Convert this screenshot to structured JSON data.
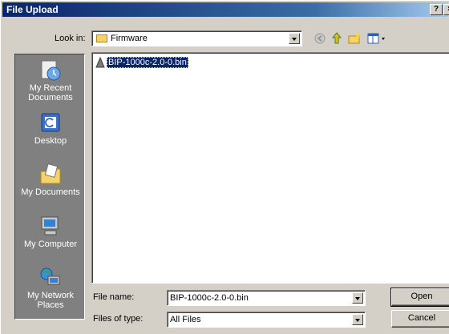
{
  "window": {
    "title": "File Upload",
    "help_glyph": "?",
    "close_glyph": "×"
  },
  "lookin": {
    "label": "Look in:",
    "value": "Firmware"
  },
  "toolbar": {
    "icons": [
      "back-icon",
      "up-folder-icon",
      "new-folder-icon",
      "view-menu-icon"
    ]
  },
  "places": [
    {
      "label": "My Recent Documents",
      "icon": "recent-documents-icon"
    },
    {
      "label": "Desktop",
      "icon": "desktop-icon"
    },
    {
      "label": "My Documents",
      "icon": "my-documents-icon"
    },
    {
      "label": "My Computer",
      "icon": "my-computer-icon"
    },
    {
      "label": "My Network Places",
      "icon": "network-places-icon"
    }
  ],
  "files": [
    {
      "name": "BIP-1000c-2.0-0.bin",
      "selected": true
    }
  ],
  "filename": {
    "label": "File name:",
    "value": "BIP-1000c-2.0-0.bin"
  },
  "filetype": {
    "label": "Files of type:",
    "value": "All Files"
  },
  "buttons": {
    "open": "Open",
    "cancel": "Cancel"
  }
}
